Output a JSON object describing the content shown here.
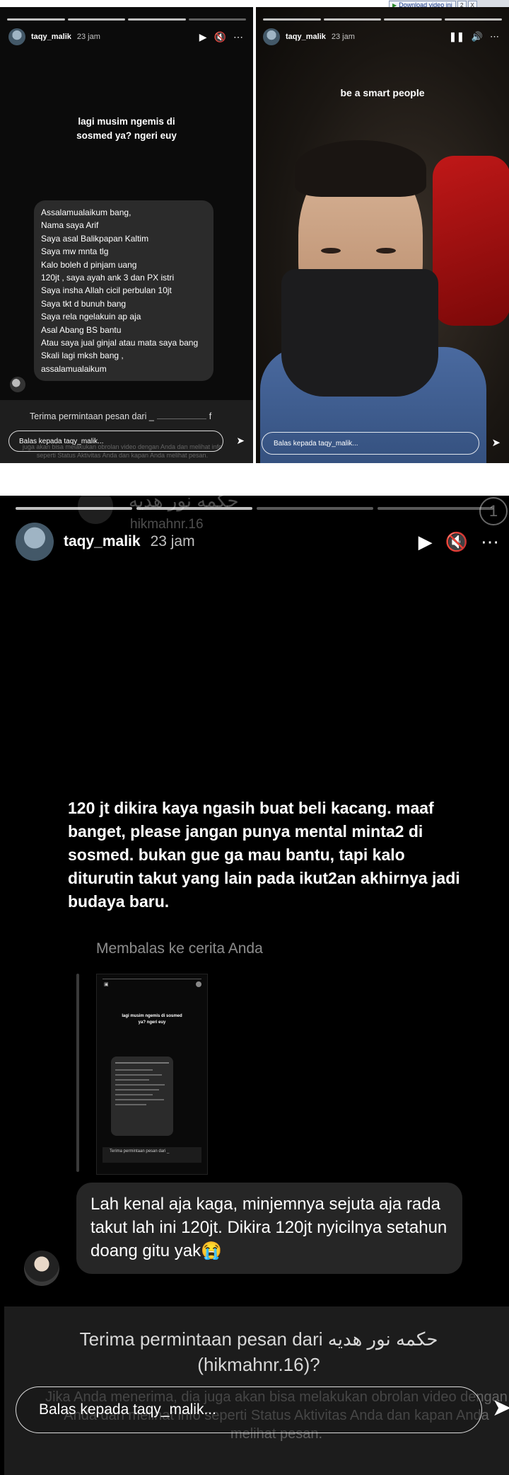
{
  "download_bar": {
    "label": "Download video ini",
    "btn2": "2",
    "btnx": "X"
  },
  "panel1": {
    "username": "taqy_malik",
    "time": "23 jam",
    "caption": "lagi musim ngemis di sosmed ya? ngeri euy",
    "message_lines": [
      "Assalamualaikum bang,",
      "Nama saya Arif",
      "Saya asal Balikpapan Kaltim",
      "Saya mw mnta tlg",
      "Kalo boleh d pinjam uang",
      "120jt , saya ayah ank 3 dan PX istri",
      "Saya insha Allah cicil perbulan 10jt",
      "Saya tkt d bunuh bang",
      "Saya rela ngelakuin ap aja",
      "Asal Abang BS bantu",
      "Atau saya jual ginjal atau mata saya bang",
      "Skali lagi mksh bang ,",
      "assalamualaikum"
    ],
    "request_text": "Terima permintaan pesan dari _",
    "request_tail": "f",
    "faded_info": "juga akan bisa melakukan obrolan video dengan Anda dan melihat info seperti Status Aktivitas Anda dan kapan Anda melihat pesan.",
    "reply_placeholder": "Balas kepada taqy_malik..."
  },
  "panel2": {
    "username": "taqy_malik",
    "time": "23 jam",
    "caption": "be a smart people",
    "reply_placeholder": "Balas kepada taqy_malik..."
  },
  "panel3": {
    "ghost_name": "حكمه نور هديه",
    "ghost_handle": "hikmahnr.16",
    "username": "taqy_malik",
    "time": "23 jam",
    "story_text": "120 jt dikira kaya ngasih buat beli kacang. maaf banget, please jangan punya mental minta2 di sosmed. bukan gue ga mau bantu, tapi kalo diturutin takut yang lain pada ikut2an akhirnya jadi budaya baru.",
    "reply_label": "Membalas ke cerita Anda",
    "mini_caption": "lagi musim ngemis di sosmed ya? ngeri euy",
    "mini_request": "Terima permintaan pesan dari _",
    "reply_message": "Lah kenal aja kaga, minjemnya sejuta aja rada takut lah ini 120jt. Dikira 120jt nyicilnya setahun doang gitu yak😭",
    "request_text": "Terima permintaan pesan dari حكمه نور هديه (hikmahnr.16)?",
    "faded_info": "Jika Anda menerima, dia juga akan bisa melakukan obrolan video dengan Anda dan melihat info seperti Status Aktivitas Anda dan kapan Anda melihat pesan.",
    "reply_placeholder": "Balas kepada taqy_malik..."
  }
}
